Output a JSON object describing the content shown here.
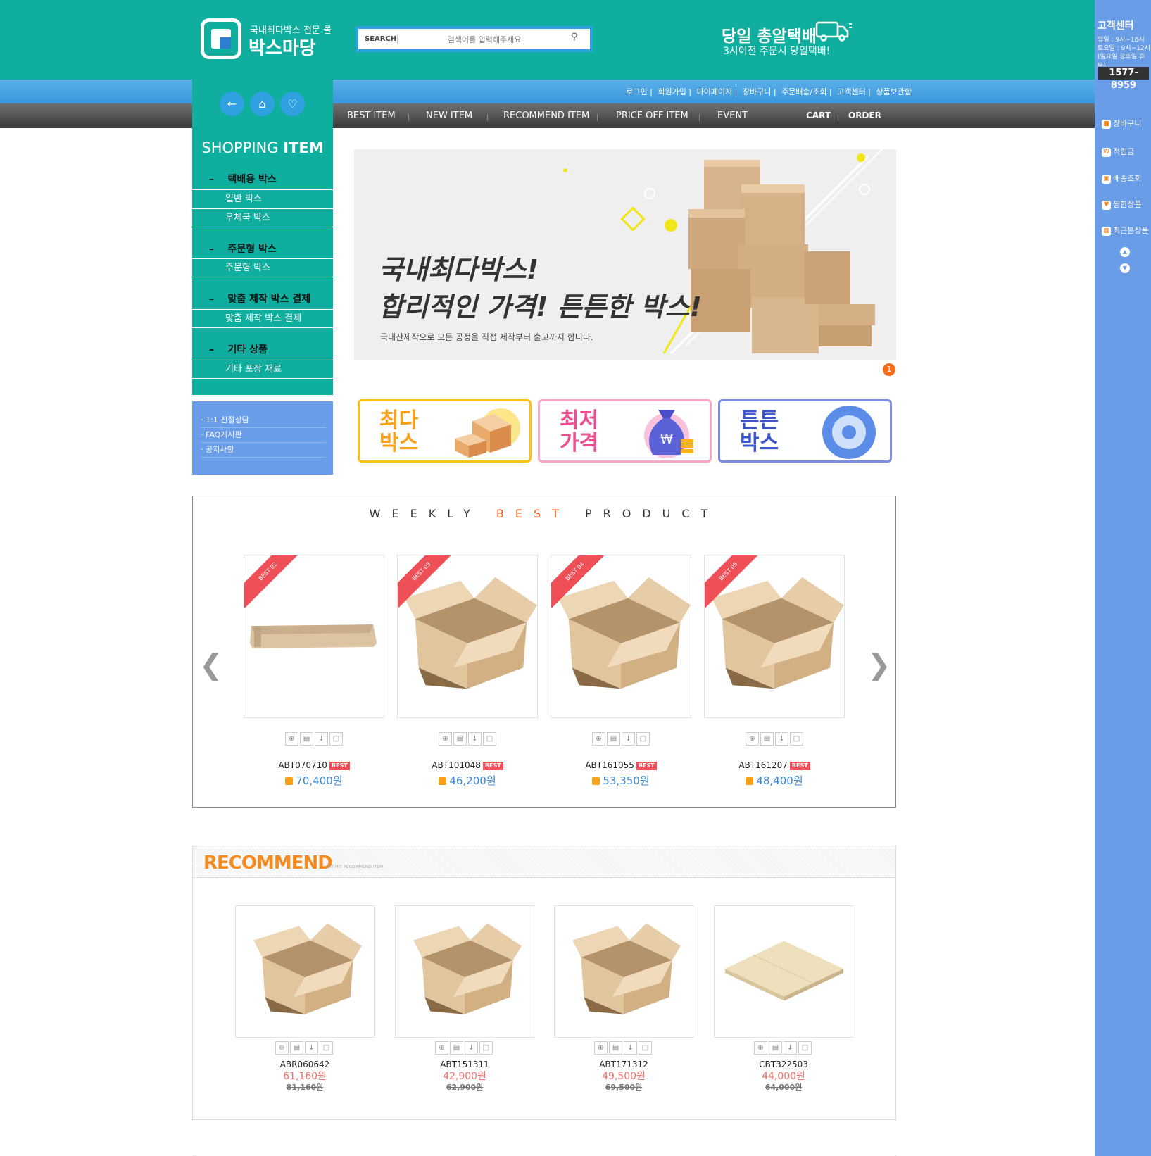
{
  "header": {
    "logo_sub": "국내최다박스 전문 몰",
    "logo_main": "박스마당",
    "search_label": "SEARCH",
    "search_placeholder": "검색어를 입력해주세요",
    "delivery_title": "당일 총알택배",
    "delivery_sub": "3시이전 주문시 당일택배!"
  },
  "util_links": [
    "로그인",
    "회원가입",
    "마이페이지",
    "장바구니",
    "주문배송/조회",
    "고객센터",
    "상품보관함"
  ],
  "nav": {
    "items": [
      "BEST ITEM",
      "NEW ITEM",
      "RECOMMEND ITEM",
      "PRICE OFF ITEM",
      "EVENT"
    ],
    "cart": "CART",
    "order": "ORDER"
  },
  "side": {
    "title_light": "SHOPPING",
    "title_bold": "ITEM",
    "categories": [
      {
        "name": "택배용 박스",
        "subs": [
          "일반 박스",
          "우체국 박스"
        ]
      },
      {
        "name": "주문형 박스",
        "subs": [
          "주문형 박스"
        ]
      },
      {
        "name": "맞춤 제작 박스 결제",
        "subs": [
          "맞춤 제작 박스 결제"
        ]
      },
      {
        "name": "기타 상품",
        "subs": [
          "기타 포장 재료"
        ]
      }
    ],
    "cs_links": [
      "1:1 친절상담",
      "FAQ게시판",
      "공지사항"
    ]
  },
  "banner": {
    "line1": "국내최다박스!",
    "line2": "합리적인 가격! 튼튼한 박스!",
    "desc": "국내산제작으로 모든 공정을 직접 제작부터 출고까지 합니다.",
    "page": "1"
  },
  "promos": [
    {
      "line1": "최다",
      "line2": "박스",
      "color": "#f8c21a"
    },
    {
      "line1": "최저",
      "line2": "가격",
      "color": "#f5a7c8"
    },
    {
      "line1": "튼튼",
      "line2": "박스",
      "color": "#7b8ee0"
    }
  ],
  "weekly": {
    "title_a": "WEEKLY",
    "title_b": "BEST",
    "title_c": "PRODUCT",
    "badge": "BEST",
    "products": [
      {
        "rank": "BEST 02",
        "code": "ABT070710",
        "price": "70,400원",
        "shape": "flat"
      },
      {
        "rank": "BEST 03",
        "code": "ABT101048",
        "price": "46,200원",
        "shape": "open"
      },
      {
        "rank": "BEST 04",
        "code": "ABT161055",
        "price": "53,350원",
        "shape": "open"
      },
      {
        "rank": "BEST 05",
        "code": "ABT161207",
        "price": "48,400원",
        "shape": "open"
      }
    ]
  },
  "recommend": {
    "title": "RECOMMEND",
    "sub": "HIT HIT RECOMMEND ITEM",
    "products": [
      {
        "code": "ABR060642",
        "price": "61,160원",
        "old": "81,160원",
        "shape": "open"
      },
      {
        "code": "ABT151311",
        "price": "42,900원",
        "old": "62,900원",
        "shape": "open"
      },
      {
        "code": "ABT171312",
        "price": "49,500원",
        "old": "69,500원",
        "shape": "open"
      },
      {
        "code": "CBT322503",
        "price": "44,000원",
        "old": "64,000원",
        "shape": "sheet"
      }
    ]
  },
  "right_sidebar": {
    "title": "고객센터",
    "hours": [
      "평일 : 9시~18시",
      "토요일 : 9시~12시",
      "(일요일 공휴일 휴무)"
    ],
    "phone": "1577-8959",
    "items": [
      "장바구니",
      "적립금",
      "배송조회",
      "찜한상품",
      "최근본상품"
    ]
  },
  "colors": {
    "teal": "#0fae9f",
    "blue": "#6a9de8",
    "orange": "#f58b1f",
    "price_blue": "#3a89d8",
    "price_red": "#f0706a"
  }
}
